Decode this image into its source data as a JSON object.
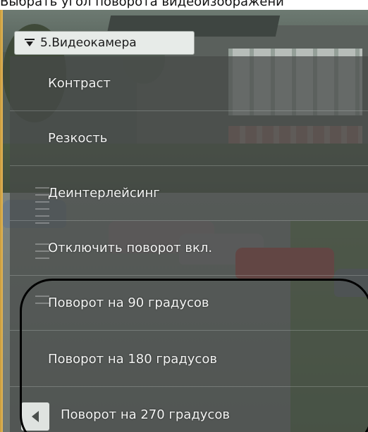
{
  "caption": "Выбрать угол поворота видеоизображени",
  "camera_button": {
    "label": "5.Видеокамера",
    "icon": "collapse-menu-icon"
  },
  "menu": {
    "items": [
      {
        "label": "Контраст"
      },
      {
        "label": "Резкость"
      },
      {
        "label": "Деинтерлейсинг"
      },
      {
        "label": "Отключить поворот вкл."
      },
      {
        "label": "Поворот на 90 градусов"
      },
      {
        "label": "Поворот на 180 градусов"
      },
      {
        "label": "Поворот на 270 градусов"
      }
    ],
    "back_icon": "chevron-left-icon"
  },
  "colors": {
    "annotation_outline": "#000000",
    "left_strip": "#d6a84a",
    "menu_text": "#f3f4f3"
  }
}
